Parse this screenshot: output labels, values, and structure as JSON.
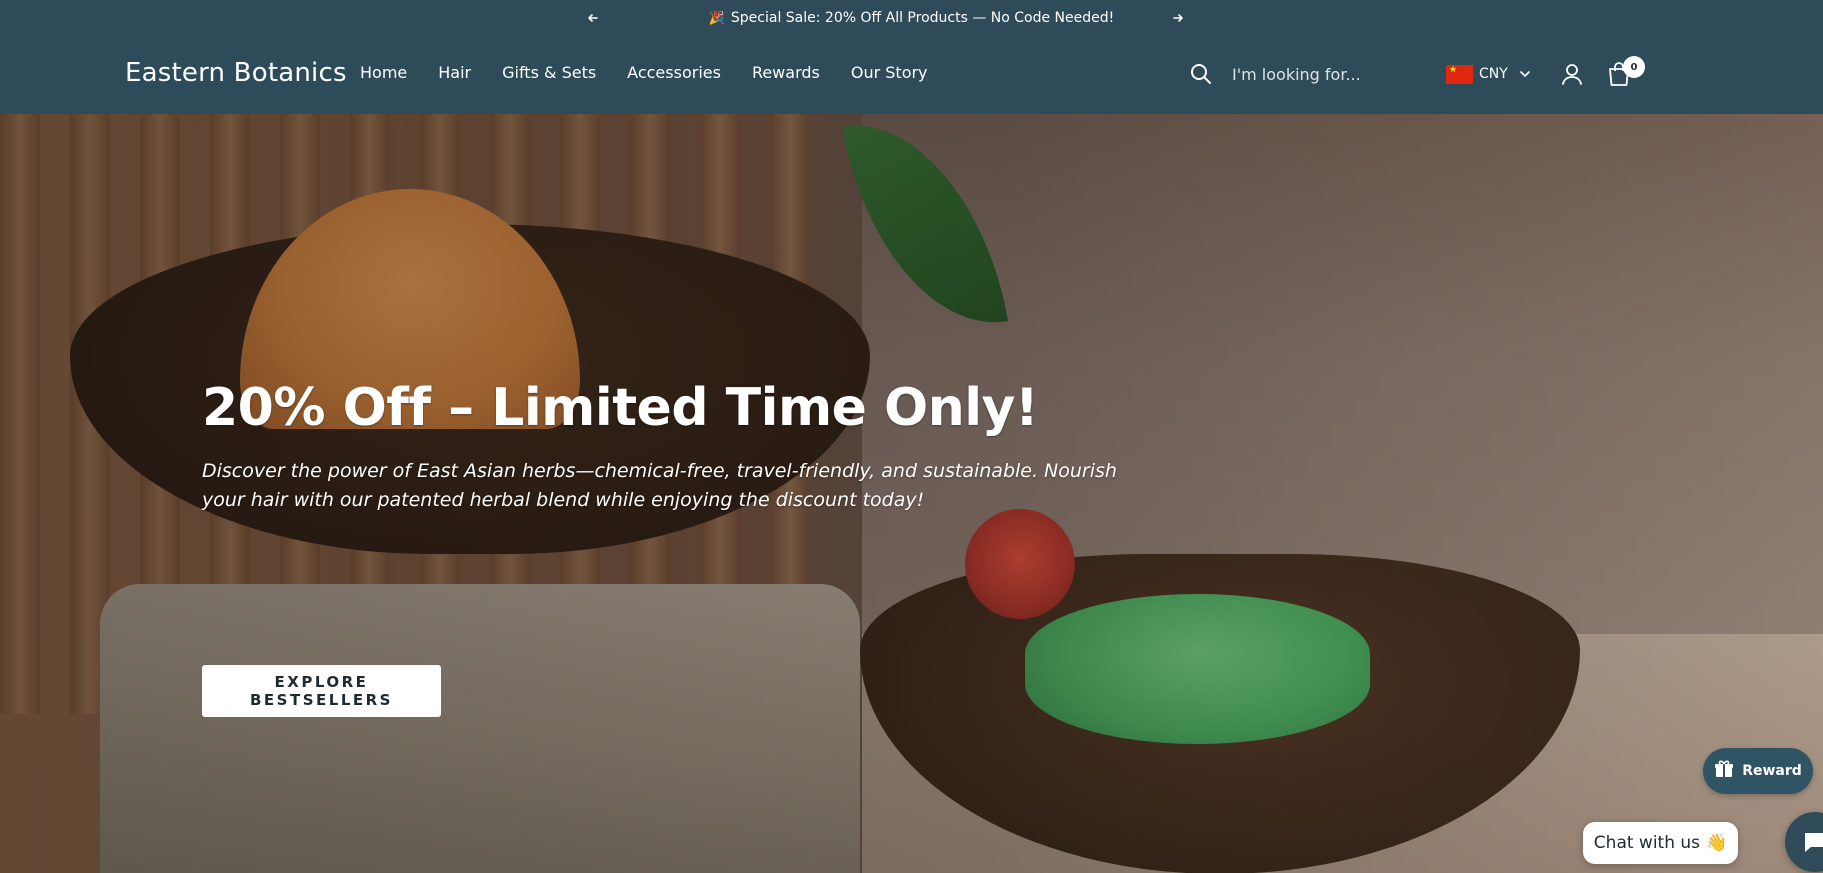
{
  "announcement": {
    "emoji": "🎉",
    "text": "Special Sale: 20% Off All Products — No Code Needed!",
    "prev_icon": "arrow-left-icon",
    "next_icon": "arrow-right-icon"
  },
  "header": {
    "logo": "Eastern Botanics",
    "nav": [
      "Home",
      "Hair",
      "Gifts & Sets",
      "Accessories",
      "Rewards",
      "Our Story"
    ],
    "search": {
      "placeholder": "I'm looking for...",
      "value": "",
      "icon": "search-icon"
    },
    "currency": {
      "code": "CNY",
      "flag": "china-flag-icon"
    },
    "account_icon": "user-icon",
    "cart": {
      "icon": "shopping-bag-icon",
      "count": "0"
    }
  },
  "hero": {
    "title": "20% Off – Limited Time Only!",
    "description": "Discover the power of East Asian herbs—chemical-free, travel-friendly, and sustainable. Nourish your hair with our patented herbal blend while enjoying the discount today!",
    "button_label": "EXPLORE BESTSELLERS"
  },
  "widgets": {
    "reward_label": "Reward",
    "reward_icon": "gift-icon",
    "chat_label": "Chat with us",
    "chat_emoji": "👋",
    "chat_icon": "chat-icon"
  },
  "colors": {
    "header_bg": "#2e4b59",
    "accent": "#2f5463",
    "text_light": "#ffffff"
  }
}
